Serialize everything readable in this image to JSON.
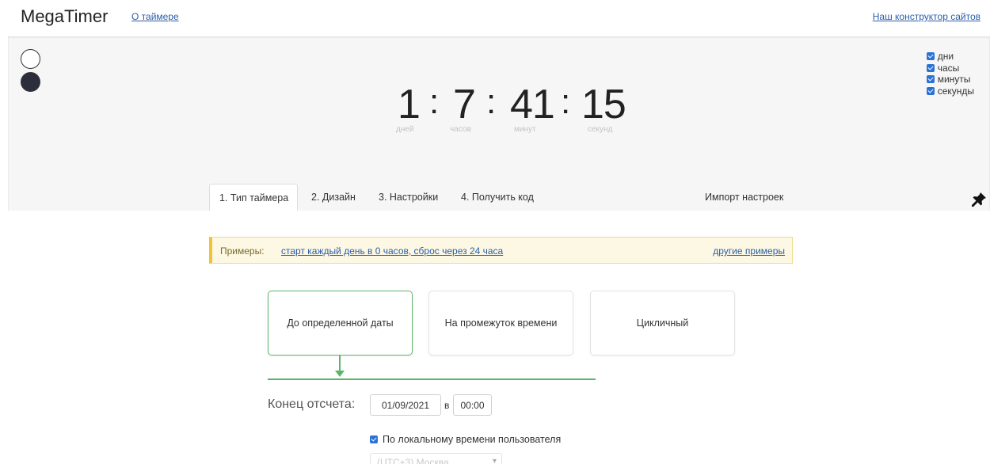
{
  "header": {
    "brand": "MegaTimer",
    "about_link": "О таймере",
    "builder_link": "Наш конструктор сайтов"
  },
  "preview": {
    "swatches": [
      {
        "name": "white",
        "color": "#ffffff"
      },
      {
        "name": "dark",
        "color": "#2c2f3b"
      }
    ],
    "timer": {
      "values": [
        "1",
        "7",
        "41",
        "15"
      ],
      "separator": ":",
      "units": [
        "дней",
        "часов",
        "минут",
        "секунд"
      ]
    },
    "unit_toggles": [
      {
        "label": "дни",
        "checked": true
      },
      {
        "label": "часы",
        "checked": true
      },
      {
        "label": "минуты",
        "checked": true
      },
      {
        "label": "секунды",
        "checked": true
      }
    ]
  },
  "tabs": {
    "items": [
      "1. Тип таймера",
      "2. Дизайн",
      "3. Настройки",
      "4. Получить код"
    ],
    "active_index": 0,
    "import": "Импорт настроек"
  },
  "examples": {
    "label": "Примеры:",
    "link": "старт каждый день в 0 часов, сброс через 24 часа",
    "more": "другие примеры"
  },
  "timer_types": {
    "cards": [
      "До определенной даты",
      "На промежуток времени",
      "Цикличный"
    ],
    "selected_index": 0
  },
  "end": {
    "label": "Конец отсчета:",
    "date": "01/09/2021",
    "at": "в",
    "time": "00:00",
    "local_time_label": "По локальному времени пользователя",
    "local_time_checked": true,
    "timezone": "(UTC+3) Москва"
  },
  "colors": {
    "accent_green": "#5cb46a",
    "link_blue": "#2a5ea8",
    "checkbox_blue": "#2a72d6",
    "notice_yellow": "#fdf8e4"
  }
}
